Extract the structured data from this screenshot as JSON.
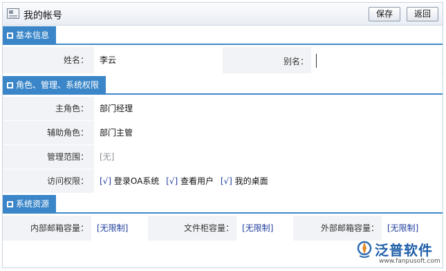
{
  "header": {
    "title": "我的帐号",
    "save_label": "保存",
    "back_label": "返回"
  },
  "basic": {
    "section_title": "基本信息",
    "name_label": "姓名：",
    "name_value": "李云",
    "alias_label": "别名：",
    "alias_value": ""
  },
  "roles": {
    "section_title": "角色、管理、系统权限",
    "main_role_label": "主角色：",
    "main_role_value": "部门经理",
    "aux_role_label": "辅助角色：",
    "aux_role_value": "部门主管",
    "scope_label": "管理范围：",
    "scope_value": "[无]",
    "access_label": "访问权限：",
    "permissions": [
      {
        "check": "[√]",
        "text": "登录OA系统"
      },
      {
        "check": "[√]",
        "text": "查看用户"
      },
      {
        "check": "[√]",
        "text": "我的桌面"
      }
    ]
  },
  "resources": {
    "section_title": "系统资源",
    "internal_mail_label": "内部邮箱容量：",
    "internal_mail_value": "[无限制]",
    "file_cabinet_label": "文件柜容量：",
    "file_cabinet_value": "[无限制]",
    "external_mail_label": "外部邮箱容量：",
    "external_mail_value": "[无限制]"
  },
  "logo": {
    "text": "泛普软件",
    "url": "www.fanpusoft.com"
  }
}
